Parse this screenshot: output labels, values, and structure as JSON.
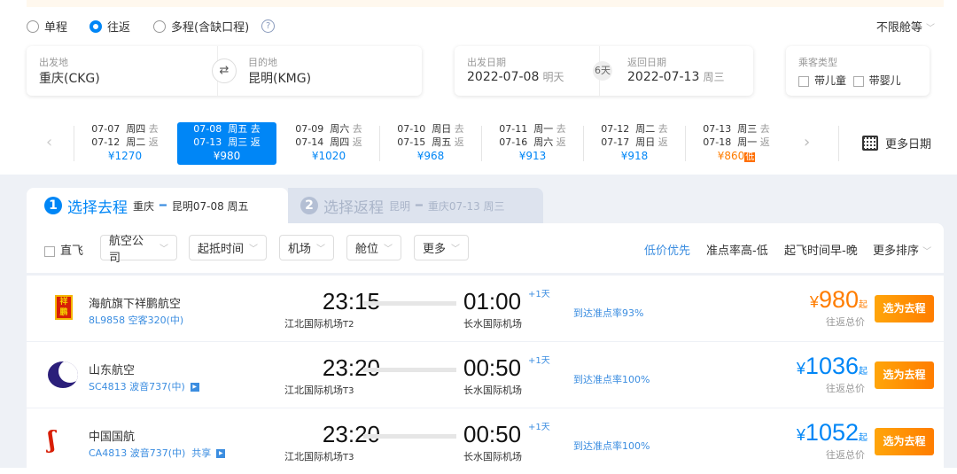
{
  "trip_type": {
    "options": [
      "单程",
      "往返",
      "多程(含缺口程)"
    ],
    "selected": 1,
    "help_icon": "?"
  },
  "cabin": "不限舱等",
  "route": {
    "from_label": "出发地",
    "from": "重庆(CKG)",
    "to_label": "目的地",
    "to": "昆明(KMG)"
  },
  "dates": {
    "depart_label": "出发日期",
    "depart": "2022-07-08",
    "depart_note": "明天",
    "duration": "6天",
    "return_label": "返回日期",
    "return": "2022-07-13",
    "return_note": "周三"
  },
  "passenger": {
    "label": "乘客类型",
    "child": "带儿童",
    "infant": "带婴儿"
  },
  "date_strip": [
    {
      "go": "07-07",
      "go_day": "周四",
      "back": "07-12",
      "back_day": "周二",
      "price": "¥1270"
    },
    {
      "go": "07-08",
      "go_day": "周五",
      "back": "07-13",
      "back_day": "周三",
      "price": "¥980",
      "selected": true
    },
    {
      "go": "07-09",
      "go_day": "周六",
      "back": "07-14",
      "back_day": "周四",
      "price": "¥1020"
    },
    {
      "go": "07-10",
      "go_day": "周日",
      "back": "07-15",
      "back_day": "周五",
      "price": "¥968"
    },
    {
      "go": "07-11",
      "go_day": "周一",
      "back": "07-16",
      "back_day": "周六",
      "price": "¥913"
    },
    {
      "go": "07-12",
      "go_day": "周二",
      "back": "07-17",
      "back_day": "周日",
      "price": "¥918"
    },
    {
      "go": "07-13",
      "go_day": "周三",
      "back": "07-18",
      "back_day": "周一",
      "price": "¥860",
      "low": "低"
    }
  ],
  "go_word": "去",
  "back_word": "返",
  "more_dates": "更多日期",
  "tabs": [
    {
      "num": "1",
      "title": "选择去程",
      "detail_from": "重庆",
      "detail_to": "昆明07-08 周五"
    },
    {
      "num": "2",
      "title": "选择返程",
      "detail_from": "昆明",
      "detail_to": "重庆07-13 周三"
    }
  ],
  "filters": {
    "direct": "直飞",
    "buttons": [
      "航空公司",
      "起抵时间",
      "机场",
      "舱位",
      "更多"
    ]
  },
  "sort": {
    "options": [
      "低价优先",
      "准点率高-低",
      "起飞时间早-晚"
    ],
    "more": "更多排序",
    "active": 0
  },
  "colors": {
    "accent": "#0086f6",
    "orange": "#ff7d00"
  },
  "flights": [
    {
      "airline": "海航旗下祥鹏航空",
      "info": "8L9858 空客320(中)",
      "share": "",
      "video": false,
      "dep": "23:15",
      "dep_apt": "江北国际机场",
      "dep_t": "T2",
      "arr": "01:00",
      "arr_apt": "长水国际机场",
      "plus": "+1天",
      "ontime": "到达准点率93%",
      "yen": "¥",
      "price": "980",
      "qi": "起",
      "price_note": "往返总价",
      "book": "选为去程",
      "lowest": true
    },
    {
      "airline": "山东航空",
      "info": "SC4813 波音737(中)",
      "share": "",
      "video": true,
      "dep": "23:20",
      "dep_apt": "江北国际机场",
      "dep_t": "T3",
      "arr": "00:50",
      "arr_apt": "长水国际机场",
      "plus": "+1天",
      "ontime": "到达准点率100%",
      "yen": "¥",
      "price": "1036",
      "qi": "起",
      "price_note": "往返总价",
      "book": "选为去程"
    },
    {
      "airline": "中国国航",
      "info": "CA4813 波音737(中)",
      "share": "共享",
      "video": true,
      "dep": "23:20",
      "dep_apt": "江北国际机场",
      "dep_t": "T3",
      "arr": "00:50",
      "arr_apt": "长水国际机场",
      "plus": "+1天",
      "ontime": "到达准点率100%",
      "yen": "¥",
      "price": "1052",
      "qi": "起",
      "price_note": "往返总价",
      "book": "选为去程"
    }
  ]
}
